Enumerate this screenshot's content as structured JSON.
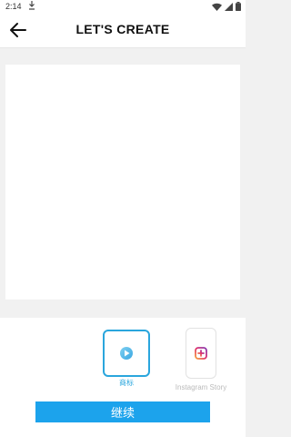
{
  "status_bar": {
    "time": "2:14",
    "download_icon": "download-icon",
    "wifi_icon": "wifi-icon",
    "signal_icon": "signal-icon",
    "battery_icon": "battery-icon"
  },
  "header": {
    "back_icon": "arrow-left-icon",
    "title": "LET'S CREATE"
  },
  "canvas": {},
  "formats": [
    {
      "label": "商标",
      "selected": true,
      "icon": "logo-mark-icon"
    },
    {
      "label": "Instagram Story",
      "selected": false,
      "icon": "instagram-add-icon"
    }
  ],
  "actions": {
    "continue_label": "继续"
  },
  "colors": {
    "accent": "#1ca3ec",
    "selected_border": "#2aa6dd",
    "background": "#f1f1f1"
  }
}
